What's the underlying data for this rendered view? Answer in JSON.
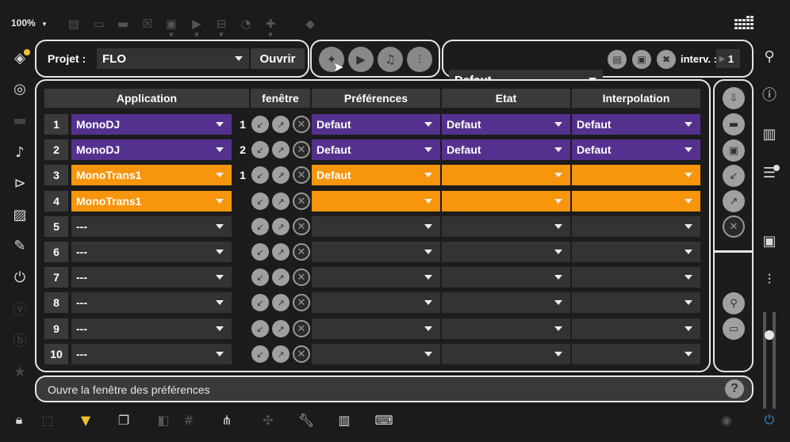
{
  "toolbar": {
    "zoom": "100%",
    "zoom_arrow": "▼"
  },
  "project": {
    "label": "Projet :",
    "name": "FLO",
    "open_button": "Ouvrir"
  },
  "preset": {
    "value": "Defaut",
    "interval_label": "interv. :",
    "interval_value": "1"
  },
  "table": {
    "headers": [
      "Application",
      "fenêtre",
      "Préférences",
      "Etat",
      "Interpolation"
    ],
    "rows": [
      {
        "num": "1",
        "app": "MonoDJ",
        "fen": "1",
        "pref": "Defaut",
        "etat": "Defaut",
        "interp": "Defaut",
        "color": "purple"
      },
      {
        "num": "2",
        "app": "MonoDJ",
        "fen": "2",
        "pref": "Defaut",
        "etat": "Defaut",
        "interp": "Defaut",
        "color": "purple"
      },
      {
        "num": "3",
        "app": "MonoTrans1",
        "fen": "1",
        "pref": "Defaut",
        "etat": "",
        "interp": "",
        "color": "orange"
      },
      {
        "num": "4",
        "app": "MonoTrans1",
        "fen": "",
        "pref": "",
        "etat": "",
        "interp": "",
        "color": "orange"
      },
      {
        "num": "5",
        "app": "---",
        "fen": "",
        "pref": "",
        "etat": "",
        "interp": "",
        "color": "dark"
      },
      {
        "num": "6",
        "app": "---",
        "fen": "",
        "pref": "",
        "etat": "",
        "interp": "",
        "color": "dark"
      },
      {
        "num": "7",
        "app": "---",
        "fen": "",
        "pref": "",
        "etat": "",
        "interp": "",
        "color": "dark"
      },
      {
        "num": "8",
        "app": "---",
        "fen": "",
        "pref": "",
        "etat": "",
        "interp": "",
        "color": "dark"
      },
      {
        "num": "9",
        "app": "---",
        "fen": "",
        "pref": "",
        "etat": "",
        "interp": "",
        "color": "dark"
      },
      {
        "num": "10",
        "app": "---",
        "fen": "",
        "pref": "",
        "etat": "",
        "interp": "",
        "color": "dark"
      }
    ]
  },
  "status": {
    "text": "Ouvre la fenêtre des préférences",
    "help": "?"
  },
  "colors": {
    "purple": "#54318f",
    "orange": "#f7950c",
    "panel_border": "#e6e6e6",
    "power_blue": "#2a8fe0"
  },
  "icons": {
    "left_sidebar": [
      "cube-icon",
      "target-icon",
      "bus-icon",
      "music-note-icon",
      "sequence-icon",
      "image-icon",
      "paperclip-icon",
      "plug-icon",
      "v-icon",
      "b-icon",
      "star-icon"
    ],
    "right_sidebar": [
      "search-icon",
      "info-icon",
      "book-icon",
      "list-icon",
      "camera-icon",
      "mixer-icon"
    ]
  }
}
